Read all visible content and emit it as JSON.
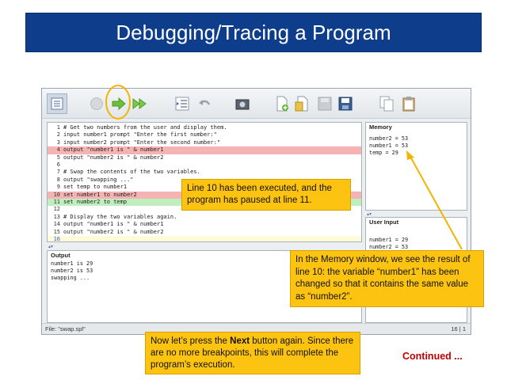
{
  "slide": {
    "title": "Debugging/Tracing a Program",
    "continued": "Continued ..."
  },
  "toolbar": {
    "buttons": [
      {
        "name": "outline-button",
        "icon": "list-icon"
      },
      {
        "name": "stop-button",
        "icon": "stop-circle-icon"
      },
      {
        "name": "next-button",
        "icon": "step-arrow-icon",
        "highlighted": true
      },
      {
        "name": "run-button",
        "icon": "double-arrow-icon"
      },
      {
        "name": "indent-button",
        "icon": "indent-icon"
      },
      {
        "name": "undo-button",
        "icon": "undo-icon"
      },
      {
        "name": "screenshot-button",
        "icon": "camera-icon"
      },
      {
        "name": "new-file-button",
        "icon": "new-file-icon"
      },
      {
        "name": "open-file-button",
        "icon": "open-file-icon"
      },
      {
        "name": "save-disabled-button",
        "icon": "disk-icon"
      },
      {
        "name": "save-button",
        "icon": "save-icon"
      },
      {
        "name": "copy-button",
        "icon": "copy-icon"
      },
      {
        "name": "paste-button",
        "icon": "clipboard-icon"
      }
    ]
  },
  "code": {
    "lines": [
      {
        "num": "1",
        "text": "# Get two numbers from the user and display them.",
        "hl": ""
      },
      {
        "num": "2",
        "text": "input number1 prompt \"Enter the first number:\"",
        "hl": ""
      },
      {
        "num": "3",
        "text": "input number2 prompt \"Enter the second number:\"",
        "hl": ""
      },
      {
        "num": "4",
        "text": "output \"number1 is \" & number1",
        "hl": "red"
      },
      {
        "num": "5",
        "text": "output \"number2 is \" & number2",
        "hl": ""
      },
      {
        "num": "6",
        "text": "",
        "hl": ""
      },
      {
        "num": "7",
        "text": "# Swap the contents of the two variables.",
        "hl": ""
      },
      {
        "num": "8",
        "text": "output \"swapping ...\"",
        "hl": ""
      },
      {
        "num": "9",
        "text": "set temp to number1",
        "hl": ""
      },
      {
        "num": "10",
        "text": "set number1 to number2",
        "hl": "red"
      },
      {
        "num": "11",
        "text": "set number2 to temp",
        "hl": "green"
      },
      {
        "num": "12",
        "text": "",
        "hl": ""
      },
      {
        "num": "13",
        "text": "# Display the two variables again.",
        "hl": ""
      },
      {
        "num": "14",
        "text": "output \"number1 is \" & number1",
        "hl": ""
      },
      {
        "num": "15",
        "text": "output \"number2 is \" & number2",
        "hl": ""
      },
      {
        "num": "16",
        "text": "",
        "hl": "yellow"
      }
    ]
  },
  "memory": {
    "title": "Memory",
    "lines": [
      "number2 = 53",
      "number1 = 53",
      "temp = 29"
    ]
  },
  "user_input": {
    "title": "User Input",
    "lines": [
      "number1 = 29",
      "number2 = 53"
    ]
  },
  "output": {
    "title": "Output",
    "lines": [
      "number1 is 29",
      "number2 is 53",
      "swapping ..."
    ]
  },
  "status": {
    "file": "File: \"swap.spl\"",
    "position": "16 | 1"
  },
  "split_arrows": "▴▾",
  "callouts": {
    "line10": "Line 10 has been executed, and the program has paused at line 11.",
    "memory": "In the Memory window, we see the result of line 10:  the variable “number1” has been changed so that it contains the same value as “number2”.",
    "next_before": "Now let’s press the ",
    "next_bold": "Next",
    "next_after": " button again. Since there are no more breakpoints, this will complete the program’s execution."
  },
  "colors": {
    "title_bg": "#0e3d8c",
    "callout_bg": "#fcc310",
    "highlight_red": "#f6b3b3",
    "highlight_green": "#bfeebf",
    "continued": "#c00000"
  }
}
